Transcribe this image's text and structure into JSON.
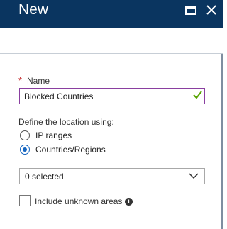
{
  "header": {
    "title": "New"
  },
  "form": {
    "name_label": "Name",
    "required_marker": "*",
    "name_value": "Blocked Countries",
    "location_label": "Define the location using:",
    "options": [
      {
        "label": "IP ranges",
        "selected": false
      },
      {
        "label": "Countries/Regions",
        "selected": true
      }
    ],
    "select_value": "0 selected",
    "include_unknown_label": "Include unknown areas",
    "include_unknown_checked": false
  },
  "colors": {
    "header_bg": "#0a3560",
    "required": "#c0181a",
    "input_focus_border": "#8a3fa0",
    "valid_check": "#57a300",
    "radio_selected": "#1565c0"
  },
  "icons": {
    "maximize": "maximize-icon",
    "close": "close-icon",
    "valid": "checkmark-icon",
    "dropdown": "chevron-down-icon",
    "info": "info-icon"
  }
}
